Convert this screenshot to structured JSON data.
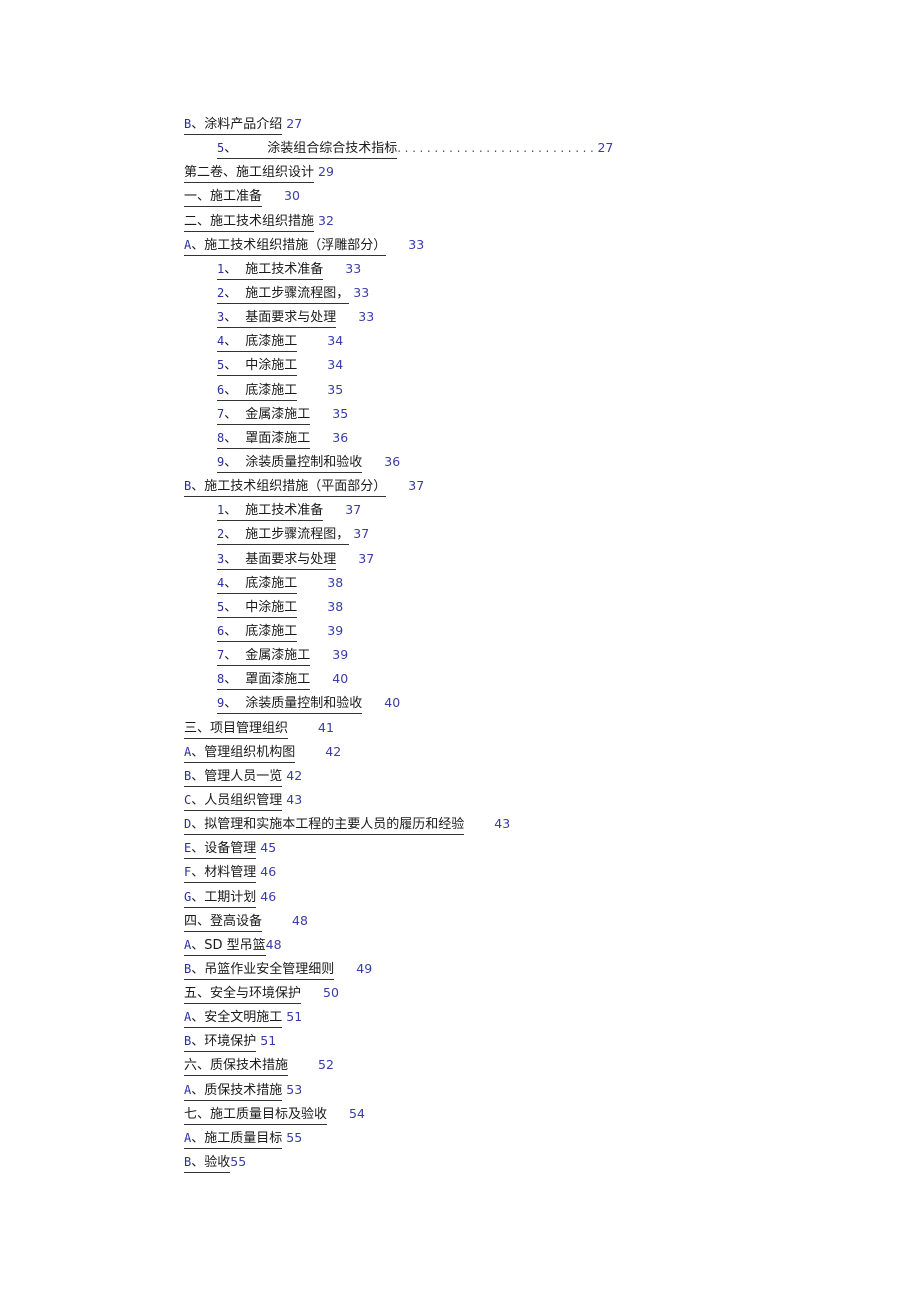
{
  "document": {
    "type": "table_of_contents",
    "colors": {
      "marker": "#2b2e9c",
      "page_number": "#3a3da8",
      "text": "#1a1a1a"
    },
    "entries": [
      {
        "marker": "B",
        "sep": "、",
        "title": "涂料产品介绍",
        "page": "27",
        "level": 1,
        "gap": "sm"
      },
      {
        "marker": "5",
        "sep": "、",
        "title": "涂装组合综合技术指标",
        "page": "27",
        "level": 2,
        "leader": "...........................",
        "gap": "none"
      },
      {
        "marker": "",
        "sep": "",
        "title": "第二卷、施工组织设计",
        "page": "29",
        "level": 1,
        "gap": "sm"
      },
      {
        "marker": "",
        "sep": "",
        "title": "一、施工准备",
        "page": "30",
        "level": 1,
        "gap": "md"
      },
      {
        "marker": "",
        "sep": "",
        "title": "二、施工技术组织措施",
        "page": "32",
        "level": 1,
        "gap": "sm"
      },
      {
        "marker": "A",
        "sep": "、",
        "title": "施工技术组织措施（浮雕部分）",
        "page": "33",
        "level": 1,
        "gap": "md"
      },
      {
        "marker": "1",
        "sep": "、",
        "title": "施工技术准备",
        "page": "33",
        "level": 2,
        "gap": "md"
      },
      {
        "marker": "2",
        "sep": "、",
        "title": "施工步骤流程图，",
        "page": "33",
        "level": 2,
        "gap": "sm"
      },
      {
        "marker": "3",
        "sep": "、",
        "title": "基面要求与处理",
        "page": "33",
        "level": 2,
        "gap": "md"
      },
      {
        "marker": "4",
        "sep": "、",
        "title": "底漆施工",
        "page": "34",
        "level": 2,
        "gap": "lg"
      },
      {
        "marker": "5",
        "sep": "、",
        "title": "中涂施工",
        "page": "34",
        "level": 2,
        "gap": "lg"
      },
      {
        "marker": "6",
        "sep": "、",
        "title": "底漆施工",
        "page": "35",
        "level": 2,
        "gap": "lg"
      },
      {
        "marker": "7",
        "sep": "、",
        "title": "金属漆施工",
        "page": "35",
        "level": 2,
        "gap": "md"
      },
      {
        "marker": "8",
        "sep": "、",
        "title": "罩面漆施工",
        "page": "36",
        "level": 2,
        "gap": "md"
      },
      {
        "marker": "9",
        "sep": "、",
        "title": "涂装质量控制和验收",
        "page": "36",
        "level": 2,
        "gap": "md"
      },
      {
        "marker": "B",
        "sep": "、",
        "title": "施工技术组织措施（平面部分）",
        "page": "37",
        "level": 1,
        "gap": "md"
      },
      {
        "marker": "1",
        "sep": "、",
        "title": "施工技术准备",
        "page": "37",
        "level": 2,
        "gap": "md"
      },
      {
        "marker": "2",
        "sep": "、",
        "title": "施工步骤流程图，",
        "page": "37",
        "level": 2,
        "gap": "sm"
      },
      {
        "marker": "3",
        "sep": "、",
        "title": "基面要求与处理",
        "page": "37",
        "level": 2,
        "gap": "md"
      },
      {
        "marker": "4",
        "sep": "、",
        "title": "底漆施工",
        "page": "38",
        "level": 2,
        "gap": "lg"
      },
      {
        "marker": "5",
        "sep": "、",
        "title": "中涂施工",
        "page": "38",
        "level": 2,
        "gap": "lg"
      },
      {
        "marker": "6",
        "sep": "、",
        "title": "底漆施工",
        "page": "39",
        "level": 2,
        "gap": "lg"
      },
      {
        "marker": "7",
        "sep": "、",
        "title": "金属漆施工",
        "page": "39",
        "level": 2,
        "gap": "md"
      },
      {
        "marker": "8",
        "sep": "、",
        "title": "罩面漆施工",
        "page": "40",
        "level": 2,
        "gap": "md"
      },
      {
        "marker": "9",
        "sep": "、",
        "title": "涂装质量控制和验收",
        "page": "40",
        "level": 2,
        "gap": "md"
      },
      {
        "marker": "",
        "sep": "",
        "title": "三、项目管理组织",
        "page": "41",
        "level": 1,
        "gap": "lg"
      },
      {
        "marker": "A",
        "sep": "、",
        "title": "管理组织机构图",
        "page": "42",
        "level": 1,
        "gap": "lg"
      },
      {
        "marker": "B",
        "sep": "、",
        "title": "管理人员一览",
        "page": "42",
        "level": 1,
        "gap": "sm"
      },
      {
        "marker": "C",
        "sep": "、",
        "title": "人员组织管理",
        "page": "43",
        "level": 1,
        "gap": "sm"
      },
      {
        "marker": "D",
        "sep": "、",
        "title": "拟管理和实施本工程的主要人员的履历和经验",
        "page": "43",
        "level": 1,
        "gap": "lg"
      },
      {
        "marker": "E",
        "sep": "、",
        "title": "设备管理",
        "page": "45",
        "level": 1,
        "gap": "sm"
      },
      {
        "marker": "F",
        "sep": "、",
        "title": "材料管理",
        "page": "46",
        "level": 1,
        "gap": "sm"
      },
      {
        "marker": "G",
        "sep": "、",
        "title": "工期计划",
        "page": "46",
        "level": 1,
        "gap": "sm"
      },
      {
        "marker": "",
        "sep": "",
        "title": "四、登高设备",
        "page": "48",
        "level": 1,
        "gap": "lg"
      },
      {
        "marker": "A",
        "sep": "、",
        "title": "SD 型吊篮",
        "page": "48",
        "level": 1,
        "gap": "none"
      },
      {
        "marker": "B",
        "sep": "、",
        "title": "吊篮作业安全管理细则",
        "page": "49",
        "level": 1,
        "gap": "md"
      },
      {
        "marker": "",
        "sep": "",
        "title": "五、安全与环境保护",
        "page": "50",
        "level": 1,
        "gap": "md"
      },
      {
        "marker": "A",
        "sep": "、",
        "title": "安全文明施工",
        "page": "51",
        "level": 1,
        "gap": "sm"
      },
      {
        "marker": "B",
        "sep": "、",
        "title": "环境保护",
        "page": "51",
        "level": 1,
        "gap": "sm"
      },
      {
        "marker": "",
        "sep": "",
        "title": "六、质保技术措施",
        "page": "52",
        "level": 1,
        "gap": "lg"
      },
      {
        "marker": "A",
        "sep": "、",
        "title": "质保技术措施",
        "page": "53",
        "level": 1,
        "gap": "sm"
      },
      {
        "marker": "",
        "sep": "",
        "title": "七、施工质量目标及验收",
        "page": "54",
        "level": 1,
        "gap": "md"
      },
      {
        "marker": "A",
        "sep": "、",
        "title": "施工质量目标",
        "page": "55",
        "level": 1,
        "gap": "sm"
      },
      {
        "marker": "B",
        "sep": "、",
        "title": "验收",
        "page": "55",
        "level": 1,
        "gap": "none"
      }
    ]
  }
}
